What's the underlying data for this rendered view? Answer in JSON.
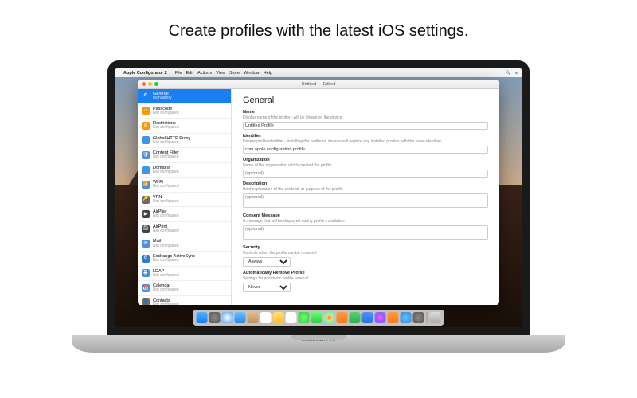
{
  "headline": "Create profiles with the latest iOS settings.",
  "laptop_label": "MacBook Pro",
  "menubar": {
    "app": "Apple Configurator 2",
    "items": [
      "File",
      "Edit",
      "Actions",
      "View",
      "Store",
      "Window",
      "Help"
    ]
  },
  "window": {
    "title": "Untitled — Edited"
  },
  "sidebar": [
    {
      "label": "General",
      "sub": "Mandatory",
      "color": "#1a7ff0",
      "selected": true,
      "icon": "⚙"
    },
    {
      "label": "Passcode",
      "sub": "Not configured",
      "color": "#ff9500",
      "icon": "🔒"
    },
    {
      "label": "Restrictions",
      "sub": "Not configured",
      "color": "#ff9500",
      "icon": "⊘"
    },
    {
      "label": "Global HTTP Proxy",
      "sub": "Not configured",
      "color": "#4a90e2",
      "icon": "🌐"
    },
    {
      "label": "Content Filter",
      "sub": "Not configured",
      "color": "#4a90e2",
      "icon": "🛡"
    },
    {
      "label": "Domains",
      "sub": "Not configured",
      "color": "#4a90e2",
      "icon": "🌐"
    },
    {
      "label": "Wi-Fi",
      "sub": "Not configured",
      "color": "#4a90e2",
      "icon": "📶"
    },
    {
      "label": "VPN",
      "sub": "Not configured",
      "color": "#6a6a6a",
      "icon": "🔑"
    },
    {
      "label": "AirPlay",
      "sub": "Not configured",
      "color": "#444",
      "icon": "▶"
    },
    {
      "label": "AirPrint",
      "sub": "Not configured",
      "color": "#444",
      "icon": "🖨"
    },
    {
      "label": "Mail",
      "sub": "Not configured",
      "color": "#4a90e2",
      "icon": "✉"
    },
    {
      "label": "Exchange ActiveSync",
      "sub": "Not configured",
      "color": "#2a7dd4",
      "icon": "E"
    },
    {
      "label": "LDAP",
      "sub": "Not configured",
      "color": "#4a90e2",
      "icon": "📇"
    },
    {
      "label": "Calendar",
      "sub": "Not configured",
      "color": "#4a90e2",
      "icon": "📅"
    },
    {
      "label": "Contacts",
      "sub": "Not configured",
      "color": "#8a6a4a",
      "icon": "👤"
    }
  ],
  "content": {
    "heading": "General",
    "groups": [
      {
        "label": "Name",
        "desc": "Display name of the profile - will be shown on the device",
        "type": "input",
        "value": "Untitled Profile"
      },
      {
        "label": "Identifier",
        "desc": "Unique profile identifier - installing the profile on devices will replace any installed profiles with the same identifier",
        "type": "input",
        "value": "com.apple.configuration.profile"
      },
      {
        "label": "Organization",
        "desc": "Name of the organization which created the profile",
        "type": "input",
        "value": "",
        "placeholder": "(optional)"
      },
      {
        "label": "Description",
        "desc": "Brief explanation of the contents or purpose of the profile",
        "type": "textarea",
        "value": "",
        "placeholder": "(optional)"
      },
      {
        "label": "Consent Message",
        "desc": "A message that will be displayed during profile installation",
        "type": "textarea",
        "value": "",
        "placeholder": "(optional)"
      },
      {
        "label": "Security",
        "desc": "Controls when the profile can be removed",
        "type": "select",
        "value": "Always"
      },
      {
        "label": "Automatically Remove Profile",
        "desc": "Settings for automatic profile removal",
        "type": "select",
        "value": "Never"
      }
    ]
  },
  "dock": [
    {
      "name": "finder",
      "color": "linear-gradient(#4ab4ff,#1a7aff)"
    },
    {
      "name": "launchpad",
      "color": "radial-gradient(circle,#888,#555)"
    },
    {
      "name": "safari",
      "color": "radial-gradient(circle,#fff,#4aa0ff)"
    },
    {
      "name": "mail",
      "color": "linear-gradient(#6ac0ff,#2a88e0)"
    },
    {
      "name": "contacts",
      "color": "linear-gradient(#e0c090,#c09060)"
    },
    {
      "name": "calendar",
      "color": "#fff"
    },
    {
      "name": "notes",
      "color": "linear-gradient(#ffe070,#ffc030)"
    },
    {
      "name": "reminders",
      "color": "#fff"
    },
    {
      "name": "messages",
      "color": "radial-gradient(circle,#6aff70,#2ad040)"
    },
    {
      "name": "facetime",
      "color": "linear-gradient(#6aff70,#2ad040)"
    },
    {
      "name": "photos",
      "color": "radial-gradient(circle,#ff6a6a,#ffd06a,#6affb0,#6aafff)"
    },
    {
      "name": "pages",
      "color": "linear-gradient(#ff9a3a,#ff7a1a)"
    },
    {
      "name": "numbers",
      "color": "linear-gradient(#5ad070,#2ab050)"
    },
    {
      "name": "keynote",
      "color": "linear-gradient(#4a90ff,#2a70e0)"
    },
    {
      "name": "itunes",
      "color": "radial-gradient(circle,#ff6ae0,#a050ff,#50a0ff)"
    },
    {
      "name": "ibooks",
      "color": "linear-gradient(#ff9a3a,#ff7a1a)"
    },
    {
      "name": "appstore",
      "color": "radial-gradient(circle,#6ac0ff,#2a88e0)"
    },
    {
      "name": "preferences",
      "color": "radial-gradient(circle,#888,#555)"
    }
  ],
  "dock_trash": {
    "name": "trash",
    "color": "linear-gradient(#ddd,#aaa)"
  }
}
